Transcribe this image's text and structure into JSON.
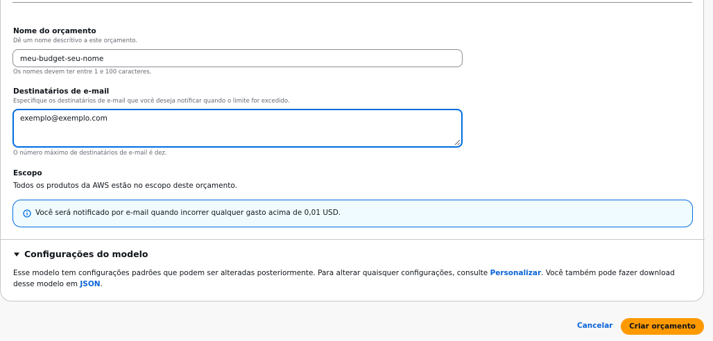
{
  "form": {
    "name_field": {
      "label": "Nome do orçamento",
      "description": "Dê um nome descritivo a este orçamento.",
      "value": "meu-budget-seu-nome",
      "constraint": "Os nomes devem ter entre 1 e 100 caracteres."
    },
    "email_field": {
      "label": "Destinatários de e-mail",
      "description": "Especifique os destinatários de e-mail que você deseja notificar quando o limite for excedido.",
      "value": "exemplo@exemplo.com",
      "constraint": "O número máximo de destinatários de e-mail é dez."
    },
    "scope": {
      "label": "Escopo",
      "text": "Todos os produtos da AWS estão no escopo deste orçamento."
    },
    "alert": {
      "icon": "info-icon",
      "text": "Você será notificado por e-mail quando incorrer qualquer gasto acima de 0,01 USD."
    }
  },
  "template_settings": {
    "title": "Configurações do modelo",
    "caret_icon": "caret-down-icon",
    "text_before_link": "Esse modelo tem configurações padrões que podem ser alteradas posteriormente. Para alterar quaisquer configurações, consulte ",
    "link_customize": "Personalizar",
    "text_middle": ". Você também pode fazer download desse modelo em ",
    "link_json": "JSON",
    "text_end": "."
  },
  "footer": {
    "cancel_label": "Cancelar",
    "create_label": "Criar orçamento"
  },
  "colors": {
    "primary_button": "#ff9900",
    "link": "#0a63d6",
    "focus_border": "#006ce0",
    "info_background": "#f0fbff"
  }
}
